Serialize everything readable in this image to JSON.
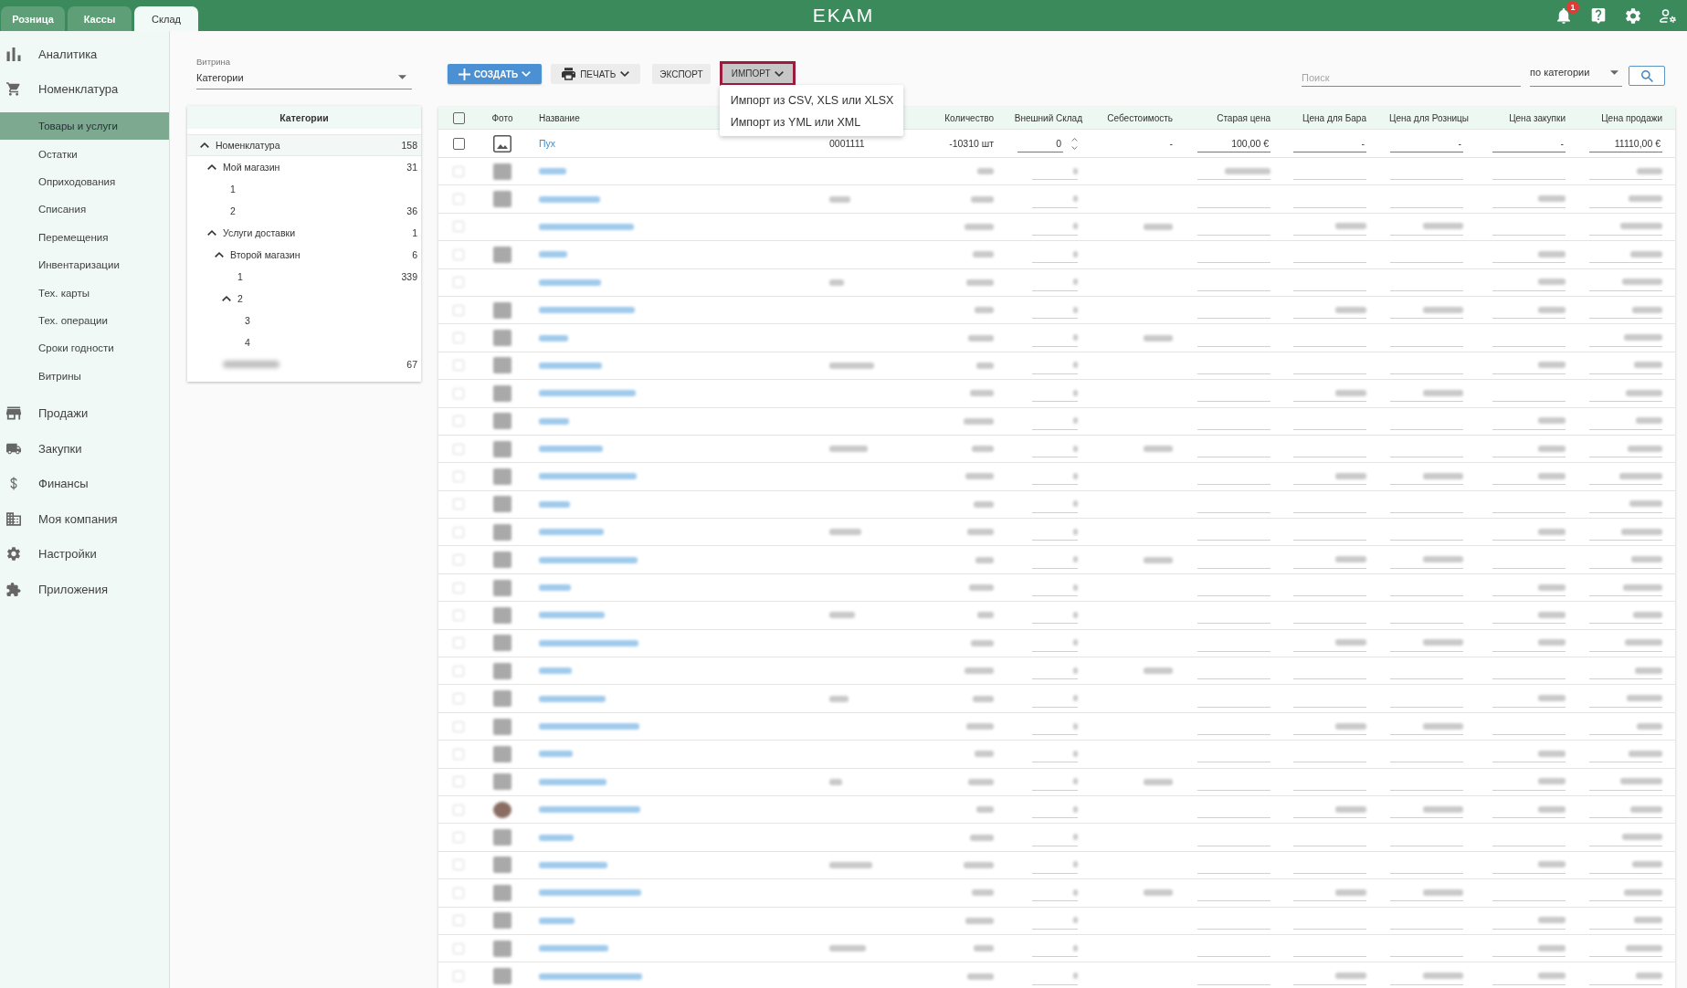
{
  "top_bar": {
    "tabs": [
      {
        "label": "Розница",
        "selected": false
      },
      {
        "label": "Кассы",
        "selected": false
      },
      {
        "label": "Склад",
        "selected": true
      }
    ],
    "logo": "EKAM",
    "notification_count": "1"
  },
  "sidebar": {
    "sections": [
      {
        "label": "Аналитика"
      },
      {
        "label": "Номенклатура",
        "children": [
          {
            "label": "Товары и услуги",
            "selected": true
          },
          {
            "label": "Остатки",
            "selected": false
          },
          {
            "label": "Оприходования",
            "selected": false
          },
          {
            "label": "Списания",
            "selected": false
          },
          {
            "label": "Перемещения",
            "selected": false
          },
          {
            "label": "Инвентаризации",
            "selected": false
          },
          {
            "label": "Тех. карты",
            "selected": false
          },
          {
            "label": "Тех. операции",
            "selected": false
          },
          {
            "label": "Сроки годности",
            "selected": false
          },
          {
            "label": "Витрины",
            "selected": false
          }
        ]
      },
      {
        "label": "Продажи"
      },
      {
        "label": "Закупки"
      },
      {
        "label": "Финансы"
      },
      {
        "label": "Моя компания"
      },
      {
        "label": "Настройки"
      },
      {
        "label": "Приложения"
      }
    ]
  },
  "showcase": {
    "label": "Витрина",
    "value": "Категории"
  },
  "categories": {
    "title": "Категории",
    "tree": [
      {
        "label": "Номенклатура",
        "count": "158",
        "selected": true,
        "expanded": true,
        "children": [
          {
            "label": "Мой магазин",
            "count": "31",
            "selected": false,
            "expanded": true,
            "children": [
              {
                "label": "1",
                "selected": false
              },
              {
                "label": "2",
                "count": "36",
                "selected": false
              }
            ]
          },
          {
            "label": "Услуги доставки",
            "count": "1",
            "selected": false,
            "expanded": true,
            "children": [
              {
                "label": "Второй магазин",
                "count": "6",
                "selected": false,
                "expanded": true,
                "children": [
                  {
                    "label": "1",
                    "count": "339",
                    "selected": false
                  },
                  {
                    "label": "2",
                    "selected": false,
                    "expanded": true,
                    "children": [
                      {
                        "label": "3",
                        "selected": false
                      },
                      {
                        "label": "4",
                        "selected": false
                      }
                    ]
                  }
                ]
              }
            ]
          },
          {
            "blurred": true,
            "count": "67",
            "selected": false
          }
        ]
      }
    ]
  },
  "toolbar": {
    "buttons": [
      {
        "kind": "primary",
        "label": "СОЗДАТЬ",
        "dropdown": true,
        "expanded": false,
        "highlighted": false
      },
      {
        "kind": "print",
        "label": "ПЕЧАТЬ",
        "dropdown": true,
        "expanded": false,
        "highlighted": false
      },
      {
        "kind": "plain",
        "label": "ЭКСПОРТ",
        "dropdown": false,
        "expanded": false,
        "highlighted": false
      },
      {
        "kind": "plain",
        "label": "ИМПОРТ",
        "dropdown": true,
        "expanded": true,
        "highlighted": true,
        "menu": [
          "Импорт из CSV, XLS или XLSX",
          "Импорт из YML или XML"
        ]
      }
    ],
    "search": {
      "placeholder": "Поиск"
    },
    "filter": {
      "value": "по категории"
    }
  },
  "table": {
    "select_all": {
      "checked": false
    },
    "columns": [
      "Фото",
      "Название",
      "Количество",
      "Внешний Склад",
      "Себестоимость",
      "Старая цена",
      "Цена для Бара",
      "Цена для Розницы",
      "Цена закупки",
      "Цена продажи"
    ],
    "rows": [
      {
        "checked": false,
        "photo": true,
        "name": "Пух",
        "column_4": "0001111",
        "quantity": "-10310 шт",
        "external_stock": "0",
        "cost": "-",
        "old_price": "100,00 €",
        "bar_price": "-",
        "retail_price": "-",
        "purchase_price": "-",
        "sale_price": "11110,00 €"
      }
    ],
    "blurred_rows": [
      {
        "kind": "icon"
      },
      {
        "kind": "icon"
      },
      {
        "kind": "empty"
      },
      {
        "kind": "icon"
      },
      {
        "kind": "empty"
      },
      {
        "kind": "icon"
      },
      {
        "kind": "icon"
      },
      {
        "kind": "icon"
      },
      {
        "kind": "icon"
      },
      {
        "kind": "icon"
      },
      {
        "kind": "icon"
      },
      {
        "kind": "icon"
      },
      {
        "kind": "icon"
      },
      {
        "kind": "icon"
      },
      {
        "kind": "icon"
      },
      {
        "kind": "icon"
      },
      {
        "kind": "icon"
      },
      {
        "kind": "icon"
      },
      {
        "kind": "icon"
      },
      {
        "kind": "icon"
      },
      {
        "kind": "icon"
      },
      {
        "kind": "icon"
      },
      {
        "kind": "icon"
      },
      {
        "kind": "picture"
      },
      {
        "kind": "icon"
      },
      {
        "kind": "icon"
      },
      {
        "kind": "icon"
      },
      {
        "kind": "icon"
      },
      {
        "kind": "icon"
      },
      {
        "kind": "icon"
      }
    ]
  }
}
